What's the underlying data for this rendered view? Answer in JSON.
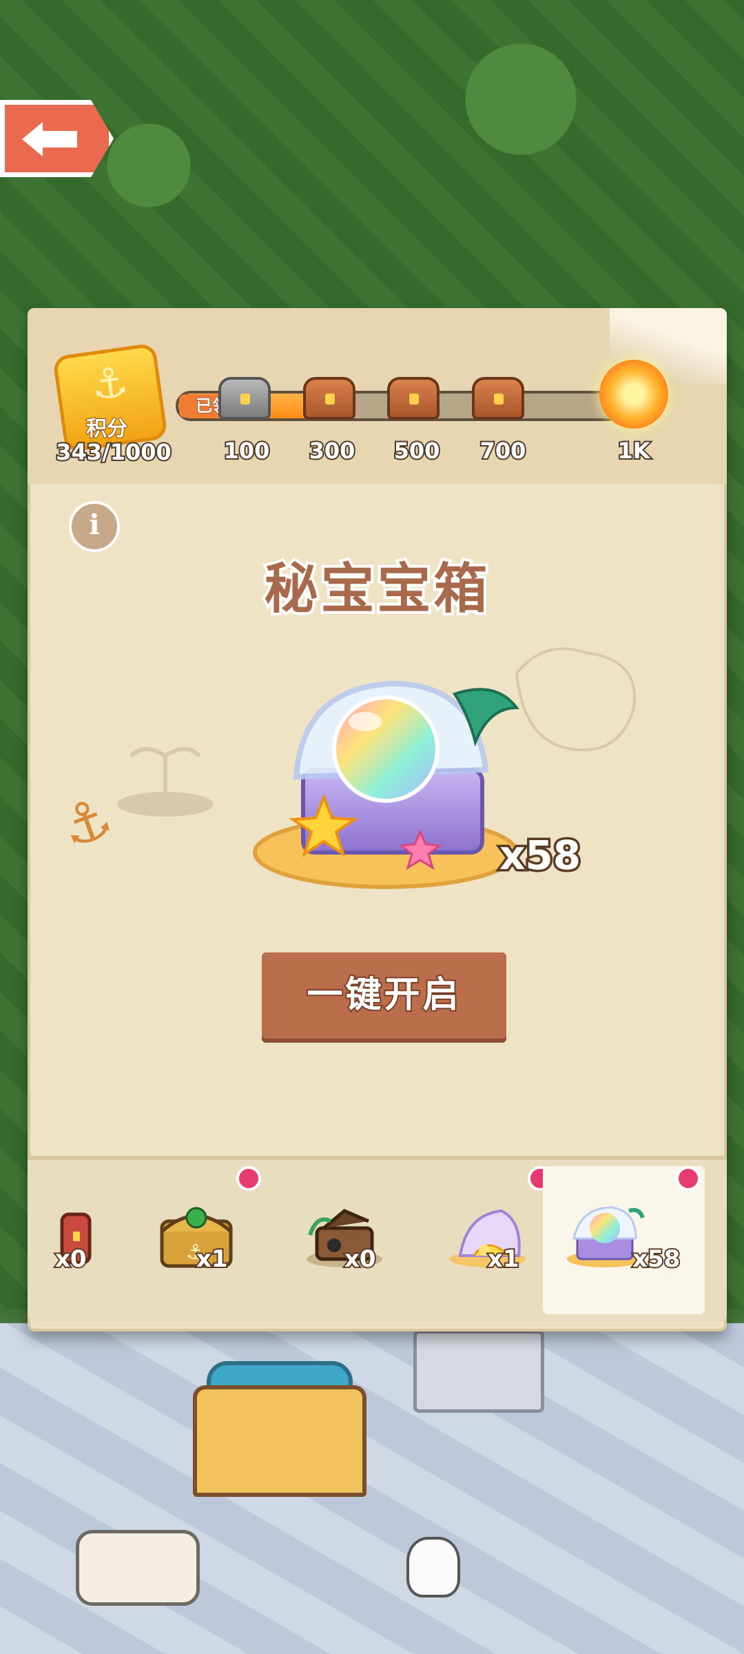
{
  "score": {
    "label": "积分",
    "current": 343,
    "max": 1000,
    "display": "343/1000",
    "icon": "anchor-badge-icon"
  },
  "progress": {
    "fraction": 0.343,
    "claimed_label": "已领取",
    "milestones": [
      {
        "label": "100",
        "status": "claimed"
      },
      {
        "label": "300",
        "status": "locked"
      },
      {
        "label": "500",
        "status": "locked"
      },
      {
        "label": "700",
        "status": "locked"
      },
      {
        "label": "1K",
        "status": "final"
      }
    ]
  },
  "chest": {
    "title": "秘宝宝箱",
    "count_text": "x58",
    "open_all_label": "一键开启",
    "icon": "rainbow-treasure-chest-icon"
  },
  "selector": {
    "items": [
      {
        "count_text": "x0",
        "icon": "red-chest-icon",
        "badge": false,
        "selected": false
      },
      {
        "count_text": "x1",
        "icon": "gold-anchor-chest-icon",
        "badge": true,
        "selected": false
      },
      {
        "count_text": "x0",
        "icon": "pirate-chest-icon",
        "badge": false,
        "selected": false
      },
      {
        "count_text": "x1",
        "icon": "shell-chest-icon",
        "badge": true,
        "selected": false
      },
      {
        "count_text": "x58",
        "icon": "rainbow-treasure-chest-icon",
        "badge": true,
        "selected": true
      }
    ]
  },
  "colors": {
    "parchment": "#efe2c4",
    "button": "#bb6e4c",
    "progress": "#ff8a13",
    "badge": "#e63b71"
  }
}
